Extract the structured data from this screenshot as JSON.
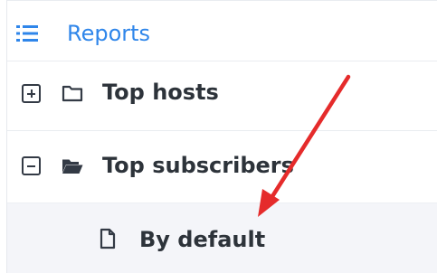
{
  "tree": {
    "header": {
      "label": "Reports",
      "icon": "list-icon",
      "accent_color": "#2f86ea"
    },
    "items": [
      {
        "label": "Top hosts",
        "toggle_icon": "expand-plus-icon",
        "folder_icon": "folder-closed-icon",
        "expanded": false
      },
      {
        "label": "Top subscribers",
        "toggle_icon": "collapse-minus-icon",
        "folder_icon": "folder-open-icon",
        "expanded": true,
        "children": [
          {
            "label": "By default",
            "icon": "document-icon"
          }
        ]
      }
    ]
  },
  "annotation": {
    "type": "arrow",
    "color": "#e52b2b",
    "icon": "red-arrow-annotation"
  }
}
